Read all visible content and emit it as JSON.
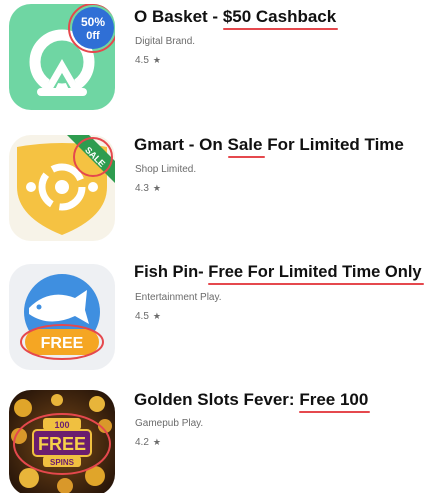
{
  "apps": [
    {
      "title_main": "O Basket - ",
      "title_highlight": "$50 Cashback",
      "title_tail": "",
      "developer": "Digital Brand.",
      "rating": "4.5",
      "badge_line1": "50%",
      "badge_line2": "0ff",
      "icon": "basket-logo-icon",
      "icon_bg": "#6fd6a3",
      "badge_color": "#2f6fd6"
    },
    {
      "title_main": "Gmart - On ",
      "title_highlight": "Sale",
      "title_tail": " For Limited Time",
      "developer": "Shop Limited.",
      "rating": "4.3",
      "badge_text": "SALE",
      "icon": "shield-logo-icon",
      "icon_bg": "#f5c242",
      "badge_color": "#2e9c4f"
    },
    {
      "title_main": "Fish Pin- ",
      "title_highlight": "Free For Limited Time Only",
      "title_tail": "",
      "developer": "Entertainment Play.",
      "rating": "4.5",
      "badge_text": "FREE",
      "icon": "fish-icon",
      "icon_bg": "#eef0f3",
      "badge_color": "#f5a623"
    },
    {
      "title_main": "Golden Slots Fever: ",
      "title_highlight": "Free 100",
      "title_tail": "",
      "developer": "Gamepub Play.",
      "rating": "4.2",
      "badge_top": "100",
      "badge_text": "FREE",
      "badge_bottom": "SPINS",
      "icon": "coins-icon",
      "icon_bg": "#3a2410",
      "badge_color": "#6b1d6e"
    }
  ],
  "accent_color": "#e5484d",
  "star_symbol": "★"
}
